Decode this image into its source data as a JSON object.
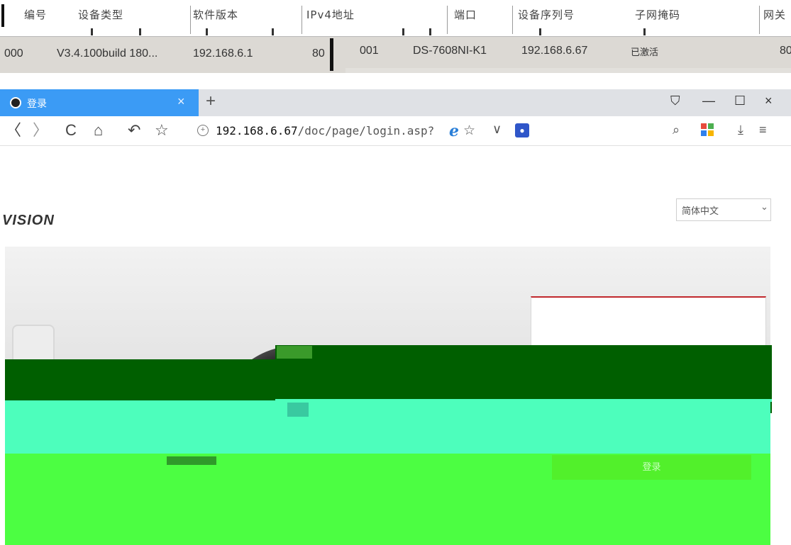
{
  "device_table": {
    "columns": [
      "编号",
      "设备类型",
      "软件版本",
      "IPv4地址",
      "端口",
      "设备序列号",
      "子网掩码",
      "网关"
    ],
    "row_left": {
      "id_fragment": "000",
      "software_version": "V3.4.100build 180...",
      "ipv4": "192.168.6.1",
      "port": "80"
    },
    "row_right": {
      "id_fragment": "001",
      "model": "DS-7608NI-K1",
      "ipv4": "192.168.6.67",
      "status": "已激活",
      "port_fragment": "80"
    }
  },
  "browser": {
    "tab": {
      "title": "登录",
      "close": "×"
    },
    "new_tab": "+",
    "window": {
      "skin": "⛉",
      "minimize": "—",
      "maximize": "☐",
      "close": "×"
    },
    "nav": {
      "back": "〈",
      "forward": "〉",
      "reload": "C",
      "home": "⌂",
      "undo": "↶",
      "favorite": "☆"
    },
    "address": {
      "host": "192.168.6.67",
      "path": "/doc/page/login.asp?"
    },
    "address_icons": {
      "ie": "e",
      "star": "☆",
      "chevron": "∨",
      "paw": "🐾"
    },
    "right_tools": {
      "search": "⌕",
      "download": "⤓",
      "menu": "≡"
    }
  },
  "page": {
    "brand": "VISION",
    "language": {
      "selected": "简体中文",
      "caret": "⌄"
    },
    "login_button": "登录"
  },
  "colors": {
    "tab_active": "#3b9bf5",
    "login_accent": "#c0282d",
    "band_dark_green": "#005f00",
    "band_cyan": "#4dfebc",
    "band_green": "#4cfe42"
  }
}
